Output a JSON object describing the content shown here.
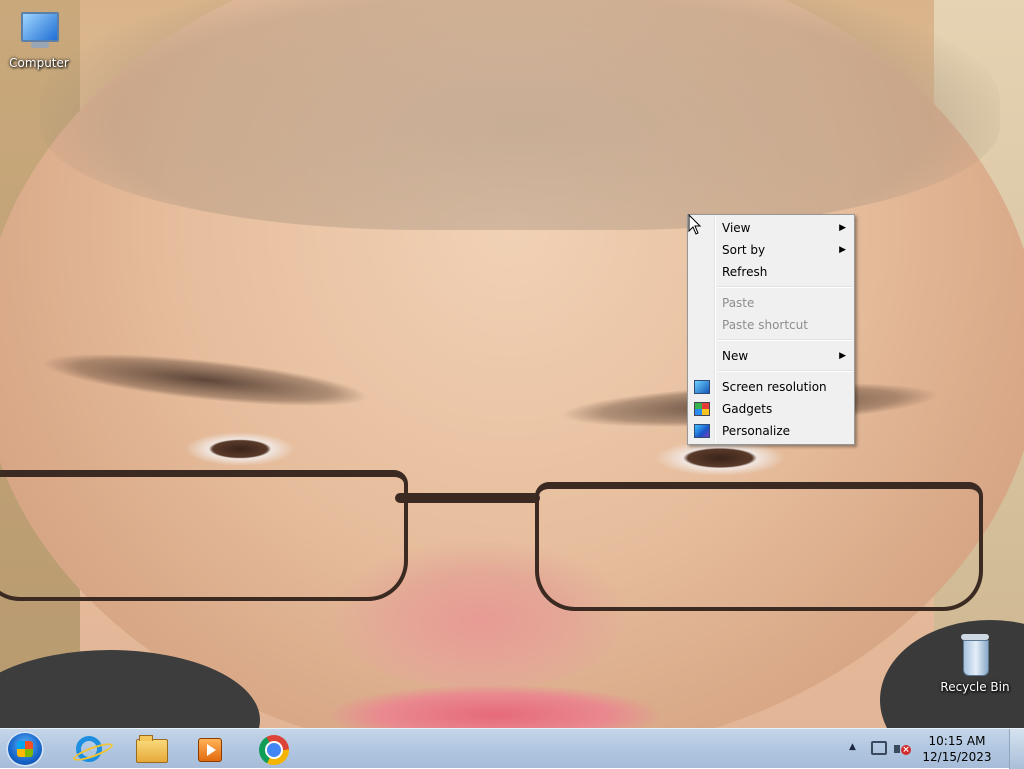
{
  "desktop": {
    "icons": [
      {
        "label": "Computer"
      },
      {
        "label": "Recycle Bin"
      }
    ]
  },
  "context_menu": {
    "items": [
      {
        "label": "View",
        "submenu": true,
        "enabled": true
      },
      {
        "label": "Sort by",
        "submenu": true,
        "enabled": true
      },
      {
        "label": "Refresh",
        "submenu": false,
        "enabled": true
      },
      {
        "label": "Paste",
        "submenu": false,
        "enabled": false
      },
      {
        "label": "Paste shortcut",
        "submenu": false,
        "enabled": false
      },
      {
        "label": "New",
        "submenu": true,
        "enabled": true
      },
      {
        "label": "Screen resolution",
        "icon": "screen-resolution-icon",
        "enabled": true
      },
      {
        "label": "Gadgets",
        "icon": "gadgets-icon",
        "enabled": true
      },
      {
        "label": "Personalize",
        "icon": "personalize-icon",
        "enabled": true
      }
    ],
    "submenu_arrow": "▶"
  },
  "taskbar": {
    "pinned": [
      {
        "icon": "internet-explorer-icon"
      },
      {
        "icon": "file-explorer-icon"
      },
      {
        "icon": "media-player-icon"
      },
      {
        "icon": "chrome-icon"
      }
    ],
    "tray": {
      "expand_arrow": "▲",
      "volume_muted_glyph": "×",
      "time": "10:15 AM",
      "date": "12/15/2023"
    }
  }
}
